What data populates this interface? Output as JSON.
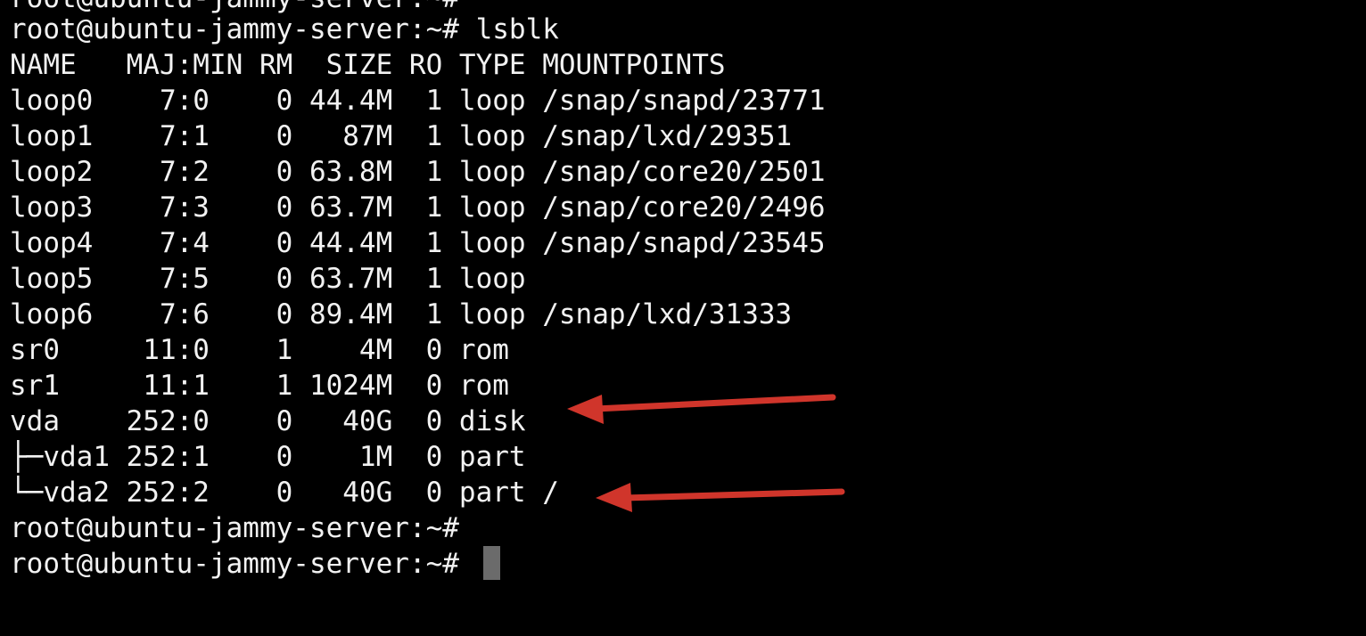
{
  "terminal": {
    "clipped_top_line": "root@ubuntu-jammy-server:~#",
    "command_line": "root@ubuntu-jammy-server:~# lsblk",
    "header": "NAME   MAJ:MIN RM  SIZE RO TYPE MOUNTPOINTS",
    "rows": [
      "loop0    7:0    0 44.4M  1 loop /snap/snapd/23771",
      "loop1    7:1    0   87M  1 loop /snap/lxd/29351",
      "loop2    7:2    0 63.8M  1 loop /snap/core20/2501",
      "loop3    7:3    0 63.7M  1 loop /snap/core20/2496",
      "loop4    7:4    0 44.4M  1 loop /snap/snapd/23545",
      "loop5    7:5    0 63.7M  1 loop",
      "loop6    7:6    0 89.4M  1 loop /snap/lxd/31333",
      "sr0     11:0    1    4M  0 rom",
      "sr1     11:1    1 1024M  0 rom",
      "vda    252:0    0   40G  0 disk",
      "├─vda1 252:1    0    1M  0 part",
      "└─vda2 252:2    0   40G  0 part /"
    ],
    "prompt_line_1": "root@ubuntu-jammy-server:~#",
    "prompt_line_2": "root@ubuntu-jammy-server:~# ",
    "text_color": "#f2f2f2",
    "background_color": "#000000",
    "cursor_color": "#6b6b6b"
  },
  "annotations": {
    "arrow_color": "#d0352b",
    "arrows": [
      "arrow-to-vda-disk",
      "arrow-to-vda2-root-partition"
    ]
  }
}
